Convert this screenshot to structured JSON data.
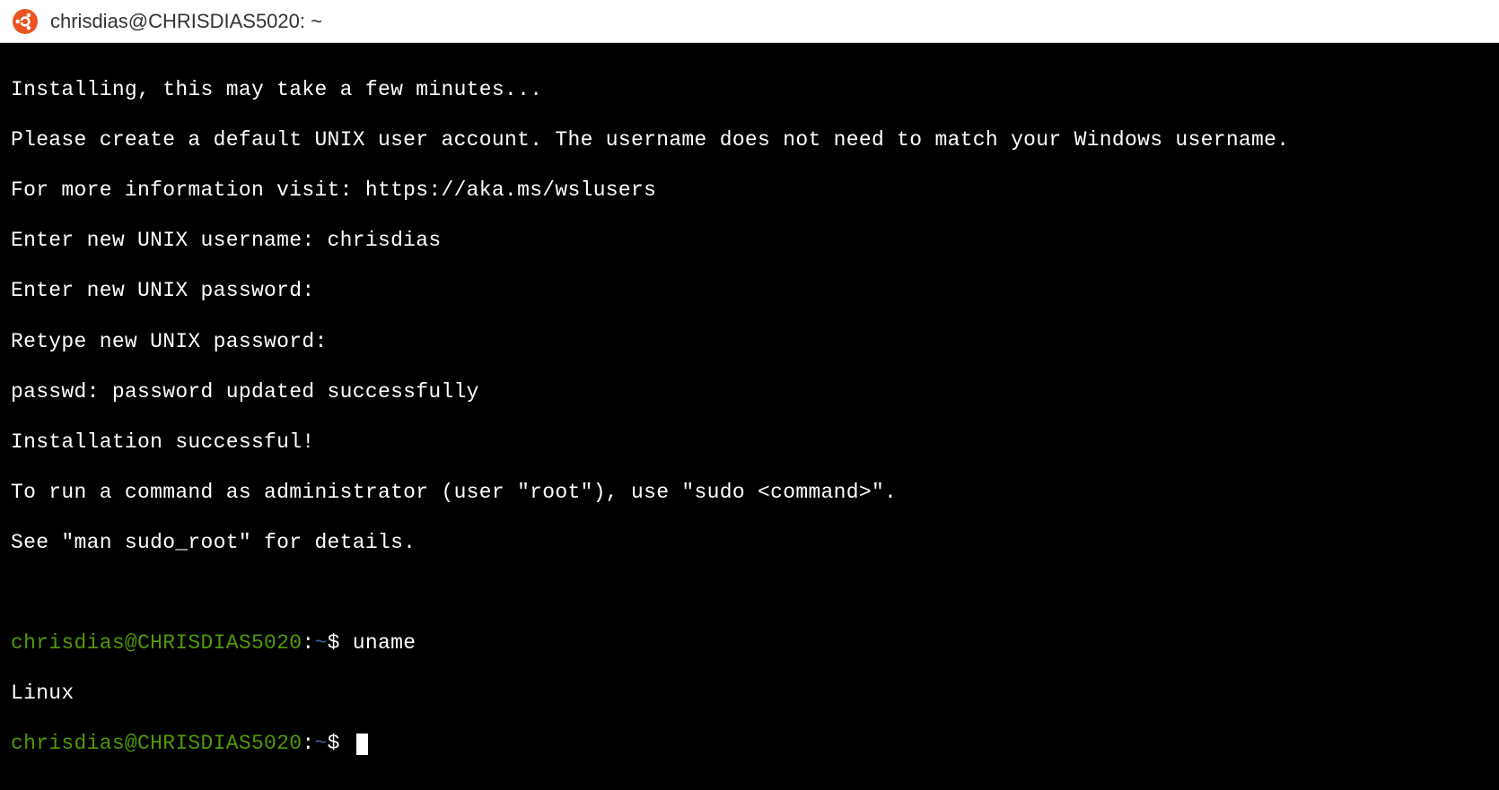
{
  "window": {
    "title": "chrisdias@CHRISDIAS5020: ~"
  },
  "terminal": {
    "lines": [
      "Installing, this may take a few minutes...",
      "Please create a default UNIX user account. The username does not need to match your Windows username.",
      "For more information visit: https://aka.ms/wslusers",
      "Enter new UNIX username: chrisdias",
      "Enter new UNIX password:",
      "Retype new UNIX password:",
      "passwd: password updated successfully",
      "Installation successful!",
      "To run a command as administrator (user \"root\"), use \"sudo <command>\".",
      "See \"man sudo_root\" for details."
    ],
    "prompt1": {
      "userhost": "chrisdias@CHRISDIAS5020",
      "colon": ":",
      "path": "~",
      "dollar": "$ ",
      "command": "uname"
    },
    "output1": "Linux",
    "prompt2": {
      "userhost": "chrisdias@CHRISDIAS5020",
      "colon": ":",
      "path": "~",
      "dollar": "$ "
    }
  }
}
